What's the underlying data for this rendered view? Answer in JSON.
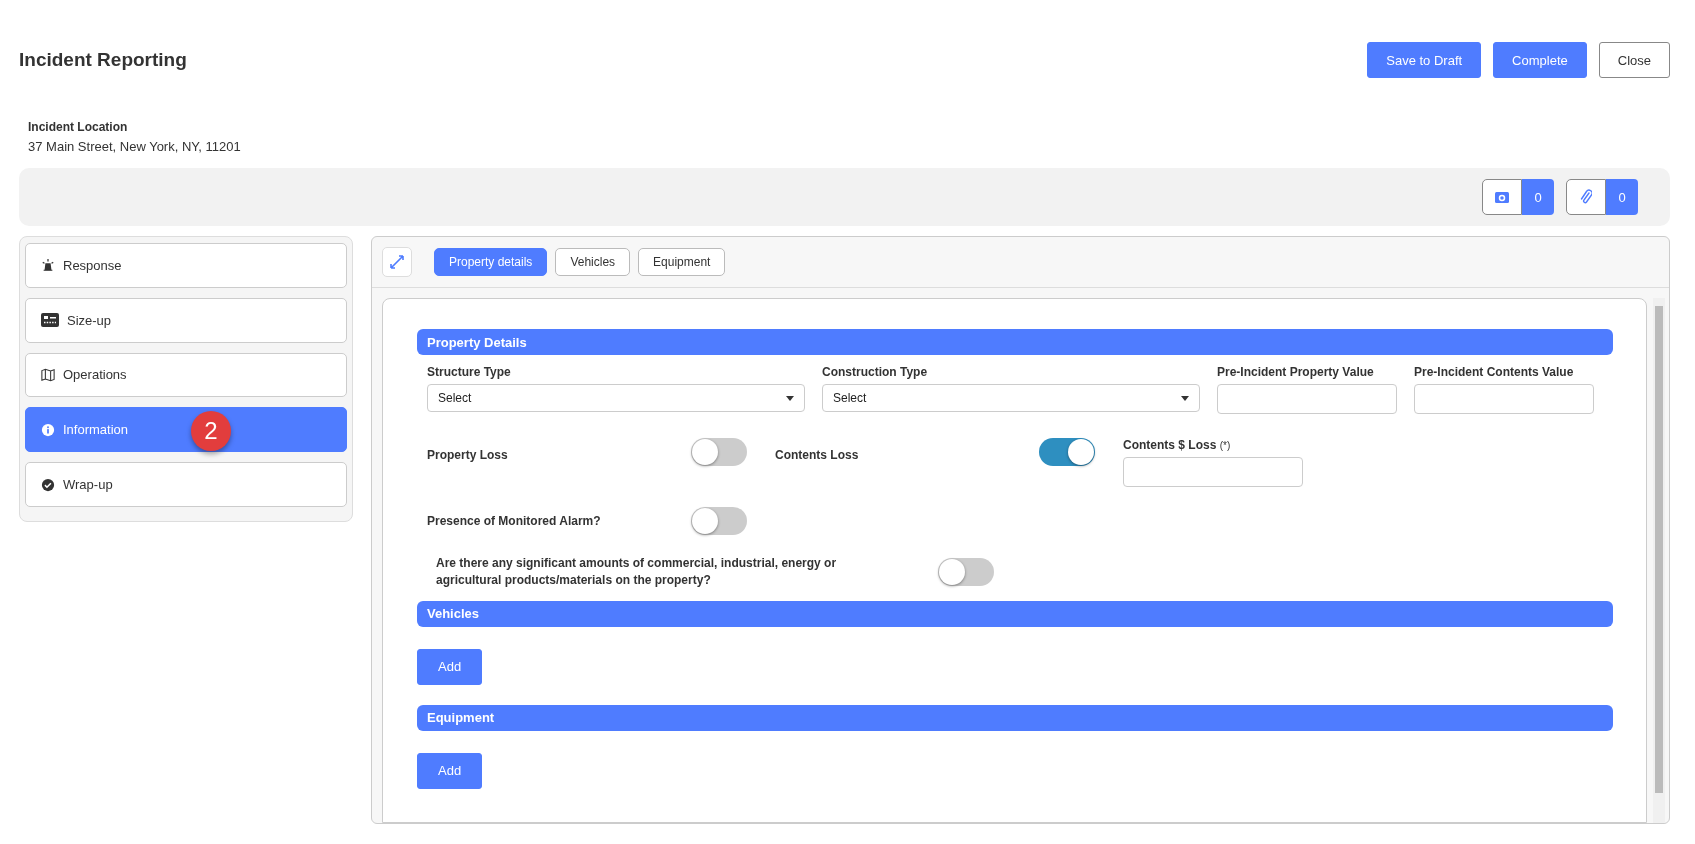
{
  "page": {
    "title": "Incident Reporting"
  },
  "actions": [
    {
      "label": "Save to Draft",
      "kind": "primary"
    },
    {
      "label": "Complete",
      "kind": "primary"
    },
    {
      "label": "Close",
      "kind": "outline"
    }
  ],
  "location": {
    "label": "Incident Location",
    "value": "37 Main Street, New York, NY, 11201"
  },
  "media_counts": [
    {
      "kind": "photo",
      "count": "0"
    },
    {
      "kind": "attachment",
      "count": "0"
    }
  ],
  "sidebar": {
    "items": [
      {
        "label": "Response",
        "kind": "beacon",
        "selected": false
      },
      {
        "label": "Size-up",
        "kind": "panel",
        "selected": false
      },
      {
        "label": "Operations",
        "kind": "map",
        "selected": false
      },
      {
        "label": "Information",
        "kind": "info",
        "selected": true,
        "badge": "2"
      },
      {
        "label": "Wrap-up",
        "kind": "check",
        "selected": false
      }
    ]
  },
  "tabs": [
    {
      "label": "Property details",
      "selected": true
    },
    {
      "label": "Vehicles",
      "selected": false
    },
    {
      "label": "Equipment",
      "selected": false
    }
  ],
  "property_details": {
    "heading": "Property Details",
    "selects": [
      {
        "label": "Structure Type",
        "value": "Select"
      },
      {
        "label": "Construction Type",
        "value": "Select"
      }
    ],
    "inputs": [
      {
        "label": "Pre-Incident Property Value"
      },
      {
        "label": "Pre-Incident Contents Value"
      }
    ],
    "property_loss": {
      "label": "Property Loss",
      "on": false
    },
    "contents_loss": {
      "label": "Contents Loss",
      "on": true
    },
    "contents_dollar_loss": {
      "label": "Contents $ Loss",
      "note": "(*)"
    },
    "monitored_alarm": {
      "label": "Presence of Monitored Alarm?",
      "on": false
    },
    "significant_materials": {
      "label": "Are there any significant amounts of commercial, industrial, energy or agricultural products/materials on the property?",
      "on": false
    }
  },
  "vehicles": {
    "heading": "Vehicles",
    "button": "Add"
  },
  "equipment": {
    "heading": "Equipment",
    "button": "Add"
  }
}
